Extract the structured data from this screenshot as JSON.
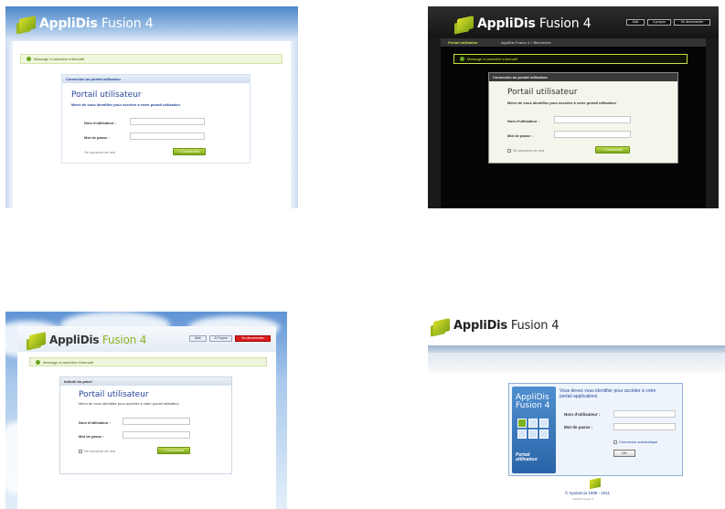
{
  "brand": {
    "name_a": "AppliDis",
    "name_b": " Fusion 4"
  },
  "common": {
    "message": "Message à caractère informatif",
    "connect_label": "» Connexion",
    "remember_label": "Se souvenir de moi"
  },
  "panel1": {
    "box_title": "Connexion au portail utilisateur",
    "portal_title": "Portail utilisateur",
    "welcome": "Merci de vous identifiez pour accéder à votre portail utilisateur",
    "user_label": "Nom d'utilisateur :",
    "pass_label": "Mot de passe :"
  },
  "panel2": {
    "nav": [
      "Aide",
      "A propos",
      "Se déconnecter"
    ],
    "breadcrumb_a": "Portail utilisateur",
    "breadcrumb_b": "AppliDis Fusion 4 > Bienvenue",
    "box_title": "Connexion au portail utilisateur",
    "portal_title": "Portail utilisateur",
    "welcome": "Merci de vous identifiez pour accéder à votre portail utilisateur",
    "user_label": "Nom d'utilisateur :",
    "pass_label": "Mot de passe :"
  },
  "panel3": {
    "nav": [
      "Aide",
      "A Propos",
      "Se déconnecter"
    ],
    "box_title": "Intitulé du panel",
    "portal_title": "Portail utilisateur",
    "welcome": "Merci de vous identifiez pour accéder à votre portail utilisateur",
    "user_label": "Nom d'utilisateur :",
    "pass_label": "Mot de passe :"
  },
  "panel4": {
    "side_title_a": "AppliDis",
    "side_title_b": "Fusion 4",
    "side_caption_a": "Portail",
    "side_caption_b": "utilisateur",
    "welcome": "Vous devez vous identifier pour accéder à votre portail applications",
    "user_label": "Nom d'utilisateur :",
    "pass_label": "Mot de passe :",
    "auto_label": "Connexion automatique",
    "ok_label": "OK",
    "copyright": "© Systancia 1998 - 2011",
    "version": "AppliDis Fusion 4"
  },
  "colors": {
    "accent_green": "#8db522",
    "blue_title": "#26479b"
  }
}
